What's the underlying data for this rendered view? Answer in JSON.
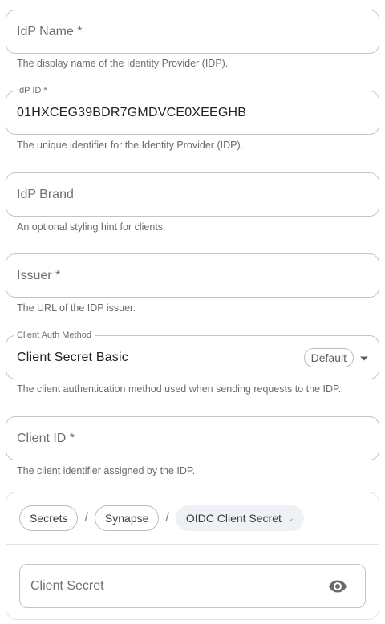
{
  "fields": {
    "idp_name": {
      "placeholder": "IdP Name *",
      "helper": "The display name of the Identity Provider (IDP)."
    },
    "idp_id": {
      "label": "IdP ID *",
      "value": "01HXCEG39BDR7GMDVCE0XEEGHB",
      "helper": "The unique identifier for the Identity Provider (IDP)."
    },
    "idp_brand": {
      "placeholder": "IdP Brand",
      "helper": "An optional styling hint for clients."
    },
    "issuer": {
      "placeholder": "Issuer *",
      "helper": "The URL of the IDP issuer."
    },
    "client_auth_method": {
      "label": "Client Auth Method",
      "value": "Client Secret Basic",
      "badge": "Default",
      "helper": "The client authentication method used when sending requests to the IDP."
    },
    "client_id": {
      "placeholder": "Client ID *",
      "helper": "The client identifier assigned by the IDP."
    }
  },
  "secret": {
    "breadcrumbs": [
      "Secrets",
      "Synapse",
      "OIDC Client Secret"
    ],
    "separator": "/",
    "placeholder": "Client Secret",
    "icons": {
      "visibility": "eye-icon",
      "dropdown": "chevron-down-icon"
    }
  }
}
